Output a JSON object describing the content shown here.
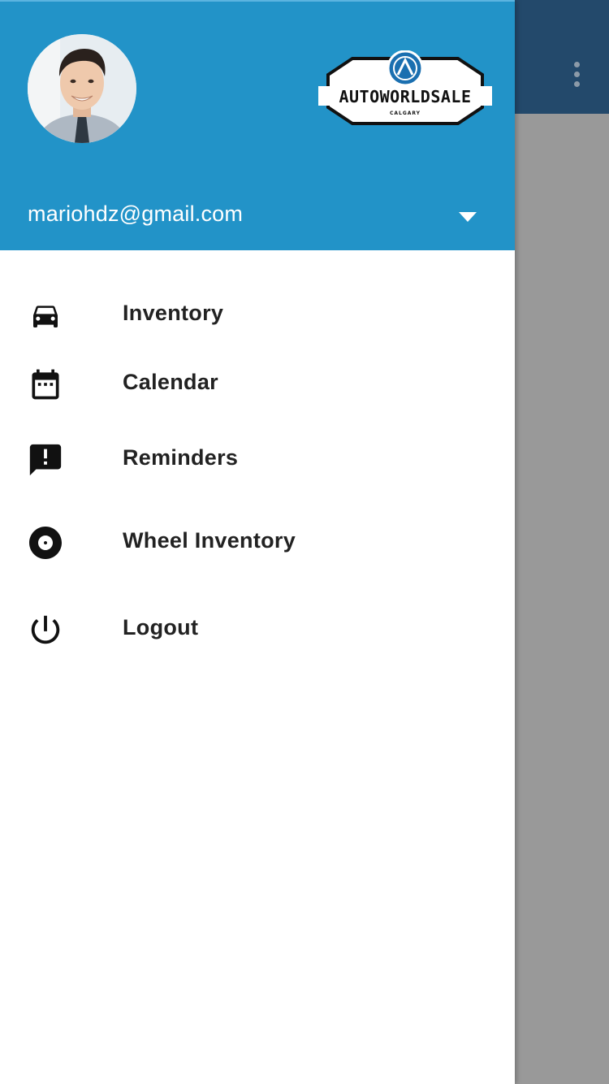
{
  "header": {
    "account_email": "mariohdz@gmail.com",
    "logo": {
      "brand_text": "AUTOWORLDSALE",
      "subtext": "CALGARY",
      "monogram": "AW"
    },
    "colors": {
      "header_bg": "#2293c8",
      "toolbar_bg": "#23496b"
    }
  },
  "menu": {
    "items": [
      {
        "label": "Inventory",
        "icon": "car-icon"
      },
      {
        "label": "Calendar",
        "icon": "calendar-icon"
      },
      {
        "label": "Reminders",
        "icon": "alert-message-icon"
      },
      {
        "label": "Wheel Inventory",
        "icon": "disc-icon"
      },
      {
        "label": "Logout",
        "icon": "power-icon"
      }
    ]
  }
}
